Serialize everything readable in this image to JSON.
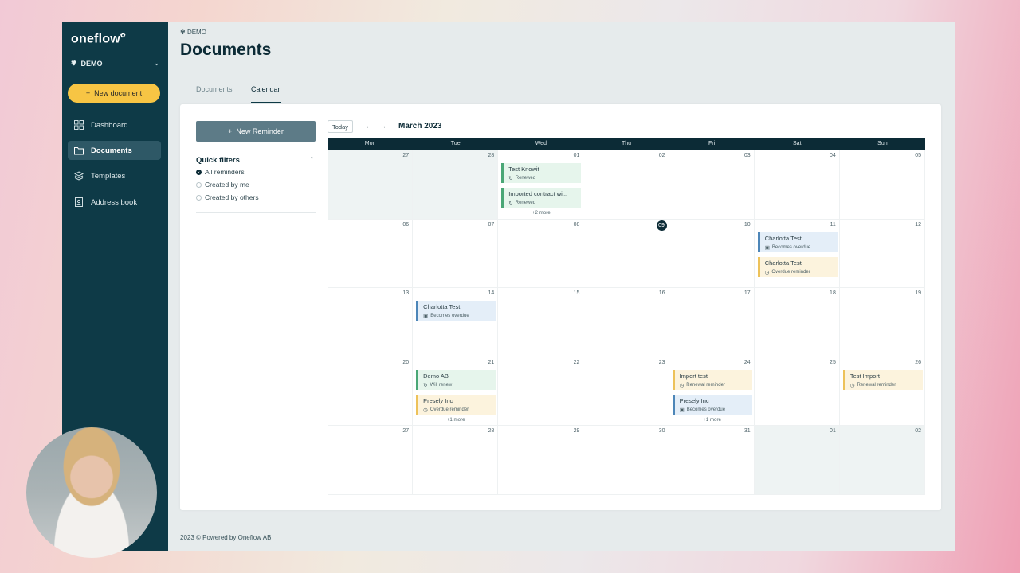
{
  "sidebar": {
    "logo": "oneflow",
    "workspace": "DEMO",
    "new_document": "New document",
    "items": [
      {
        "label": "Dashboard",
        "icon": "grid-icon"
      },
      {
        "label": "Documents",
        "icon": "folder-icon",
        "active": true
      },
      {
        "label": "Templates",
        "icon": "layers-icon"
      },
      {
        "label": "Address book",
        "icon": "contact-book-icon"
      }
    ]
  },
  "header": {
    "breadcrumb": "DEMO",
    "title": "Documents",
    "tabs": [
      {
        "label": "Documents"
      },
      {
        "label": "Calendar",
        "active": true
      }
    ]
  },
  "panel": {
    "new_reminder": "New Reminder",
    "quick_filters": "Quick filters",
    "filters": [
      {
        "label": "All reminders",
        "selected": true
      },
      {
        "label": "Created by me",
        "selected": false
      },
      {
        "label": "Created by others",
        "selected": false
      }
    ]
  },
  "calendar": {
    "today_button": "Today",
    "month": "March 2023",
    "days": [
      "Mon",
      "Tue",
      "Wed",
      "Thu",
      "Fri",
      "Sat",
      "Sun"
    ],
    "weeks": [
      [
        "27",
        "28",
        "01",
        "02",
        "03",
        "04",
        "05"
      ],
      [
        "06",
        "07",
        "08",
        "09",
        "10",
        "11",
        "12"
      ],
      [
        "13",
        "14",
        "15",
        "16",
        "17",
        "18",
        "19"
      ],
      [
        "20",
        "21",
        "22",
        "23",
        "24",
        "25",
        "26"
      ],
      [
        "27",
        "28",
        "29",
        "30",
        "31",
        "01",
        "02"
      ]
    ],
    "events": {
      "w0_wed_1": {
        "title": "Test Knowit",
        "status": "Renewed"
      },
      "w0_wed_2": {
        "title": "Imported contract wi...",
        "status": "Renewed"
      },
      "w0_wed_more": "+2 more",
      "w1_sat_1": {
        "title": "Charlotta Test",
        "status": "Becomes overdue"
      },
      "w1_sat_2": {
        "title": "Charlotta Test",
        "status": "Overdue reminder"
      },
      "w2_tue_1": {
        "title": "Charlotta Test",
        "status": "Becomes overdue"
      },
      "w3_tue_1": {
        "title": "Demo AB",
        "status": "Will renew"
      },
      "w3_tue_2": {
        "title": "Presely Inc",
        "status": "Overdue reminder"
      },
      "w3_tue_more": "+1 more",
      "w3_fri_1": {
        "title": "Import test",
        "status": "Renewal reminder"
      },
      "w3_fri_2": {
        "title": "Presely Inc",
        "status": "Becomes overdue"
      },
      "w3_fri_more": "+1 more",
      "w3_sun_1": {
        "title": "Test Import",
        "status": "Renewal reminder"
      }
    }
  },
  "footer": "2023 © Powered by Oneflow AB",
  "colors": {
    "sidebar": "#0e3a47",
    "accent_yellow": "#f7c544",
    "event_green": "#4aa776",
    "event_blue": "#4d86b8",
    "event_yellow": "#edc25a"
  }
}
